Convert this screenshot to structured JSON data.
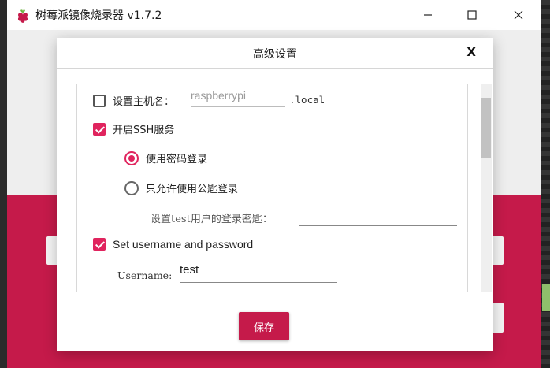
{
  "window": {
    "title": "树莓派镜像烧录器 v1.7.2"
  },
  "dialog": {
    "title": "高级设置",
    "close_label": "X",
    "save_label": "保存"
  },
  "settings": {
    "hostname": {
      "label": "设置主机名：",
      "checked": false,
      "placeholder": "raspberrypi",
      "suffix": ".local"
    },
    "ssh": {
      "label": "开启SSH服务",
      "checked": true,
      "options": [
        {
          "label": "使用密码登录",
          "selected": true
        },
        {
          "label": "只允许使用公匙登录",
          "selected": false
        }
      ],
      "pubkey_label": "设置test用户的登录密匙：",
      "pubkey_value": ""
    },
    "user": {
      "label": "Set username and password",
      "checked": true,
      "username_label": "Username:",
      "username_value": "test"
    }
  },
  "colors": {
    "accent": "#e0245e",
    "brand": "#c51a4a"
  }
}
